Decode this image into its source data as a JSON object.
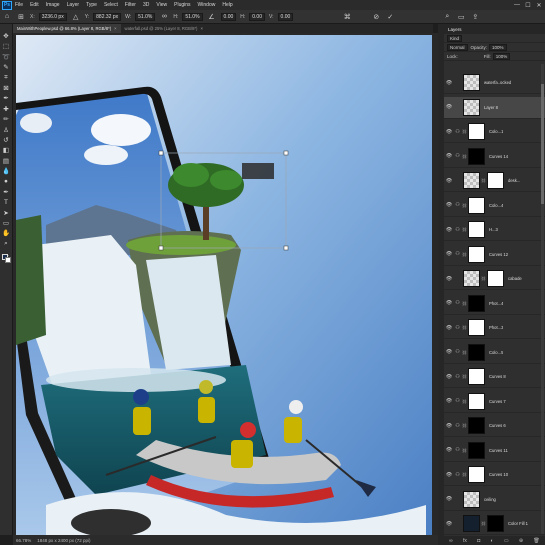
{
  "menubar": {
    "logo": "Ps",
    "items": [
      "File",
      "Edit",
      "Image",
      "Layer",
      "Type",
      "Select",
      "Filter",
      "3D",
      "View",
      "Plugins",
      "Window",
      "Help"
    ],
    "win_min": "—",
    "win_max": "☐",
    "win_close": "✕"
  },
  "options": {
    "x_label": "X:",
    "x_value": "3236.0 px",
    "y_label": "Y:",
    "y_value": "882.32 px",
    "w_label": "W:",
    "w_value": "51.0%",
    "h_label": "H:",
    "h_value": "51.0%",
    "angle_value": "0.00",
    "h_skew": "0.00",
    "v_skew": "0.00"
  },
  "tabs": [
    {
      "label": "MainWithPeoplew.psd @ 66.8% (Layer 8, RGB/8*)",
      "close": "×"
    },
    {
      "label": "waterfall.psd @ 25% (Layer 8, RGB/8*)",
      "close": "×"
    }
  ],
  "status": {
    "zoom": "66.78%",
    "doc": "1848 px x 2400 px (72 ppi)"
  },
  "panel": {
    "title": "Layers",
    "kind": "Kind",
    "blend": "Normal",
    "opacity_label": "Opacity:",
    "opacity_value": "100%",
    "lock_label": "Lock:",
    "fill_label": "Fill:",
    "fill_value": "100%"
  },
  "layers": [
    {
      "name": "waterfa..ocked",
      "thumb": "checker",
      "adj": "",
      "mask": "",
      "selected": false
    },
    {
      "name": "Layer 8",
      "thumb": "checker",
      "adj": "",
      "mask": "",
      "selected": true
    },
    {
      "name": "Colo...1",
      "thumb": "",
      "adj": "⚇",
      "mask": "white",
      "selected": false
    },
    {
      "name": "Curves 14",
      "thumb": "",
      "adj": "⚇",
      "mask": "black",
      "selected": false
    },
    {
      "name": "desk...",
      "thumb": "checker",
      "adj": "",
      "mask": "white",
      "selected": false
    },
    {
      "name": "Colo...4",
      "thumb": "",
      "adj": "⚇",
      "mask": "white",
      "selected": false
    },
    {
      "name": "H...3",
      "thumb": "",
      "adj": "⚇",
      "mask": "white",
      "selected": false
    },
    {
      "name": "Curves 12",
      "thumb": "",
      "adj": "⚇",
      "mask": "white",
      "selected": false
    },
    {
      "name": "cabade",
      "thumb": "checker",
      "adj": "",
      "mask": "white",
      "selected": false
    },
    {
      "name": "Phot...4",
      "thumb": "",
      "adj": "⚇",
      "mask": "black",
      "selected": false
    },
    {
      "name": "Phot...3",
      "thumb": "",
      "adj": "⚇",
      "mask": "white",
      "selected": false
    },
    {
      "name": "Colo...5",
      "thumb": "",
      "adj": "⚇",
      "mask": "black",
      "selected": false
    },
    {
      "name": "Curves 8",
      "thumb": "",
      "adj": "⚇",
      "mask": "white",
      "selected": false
    },
    {
      "name": "Curves 7",
      "thumb": "",
      "adj": "⚇",
      "mask": "white",
      "selected": false
    },
    {
      "name": "Curves 6",
      "thumb": "",
      "adj": "⚇",
      "mask": "black",
      "selected": false
    },
    {
      "name": "Curves 11",
      "thumb": "",
      "adj": "⚇",
      "mask": "black",
      "selected": false
    },
    {
      "name": "Curves 10",
      "thumb": "",
      "adj": "⚇",
      "mask": "white",
      "selected": false
    },
    {
      "name": "ceiling",
      "thumb": "checker",
      "adj": "",
      "mask": "",
      "selected": false
    },
    {
      "name": "Color Fill 1",
      "thumb": "dark",
      "adj": "",
      "mask": "black",
      "selected": false
    }
  ],
  "colors": {
    "accent": "#31a8ff",
    "fg_swatch": "#1b2d4a",
    "bg_swatch": "#ffffff"
  }
}
